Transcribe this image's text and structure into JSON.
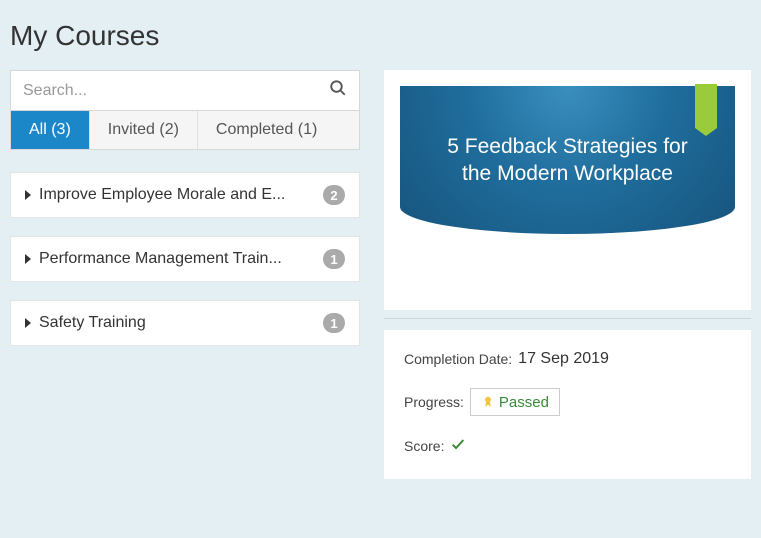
{
  "page": {
    "title": "My Courses"
  },
  "search": {
    "placeholder": "Search..."
  },
  "tabs": [
    {
      "label": "All (3)",
      "active": true
    },
    {
      "label": "Invited (2)",
      "active": false
    },
    {
      "label": "Completed (1)",
      "active": false
    }
  ],
  "courses": [
    {
      "title": "Improve Employee Morale and E...",
      "count": "2"
    },
    {
      "title": "Performance Management Train...",
      "count": "1"
    },
    {
      "title": "Safety Training",
      "count": "1"
    }
  ],
  "selectedCourse": {
    "heroText": "5 Feedback Strategies for the Modern Workplace",
    "completion": {
      "label": "Completion Date:",
      "value": "17 Sep 2019"
    },
    "progress": {
      "label": "Progress:",
      "status": "Passed"
    },
    "score": {
      "label": "Score:"
    }
  }
}
